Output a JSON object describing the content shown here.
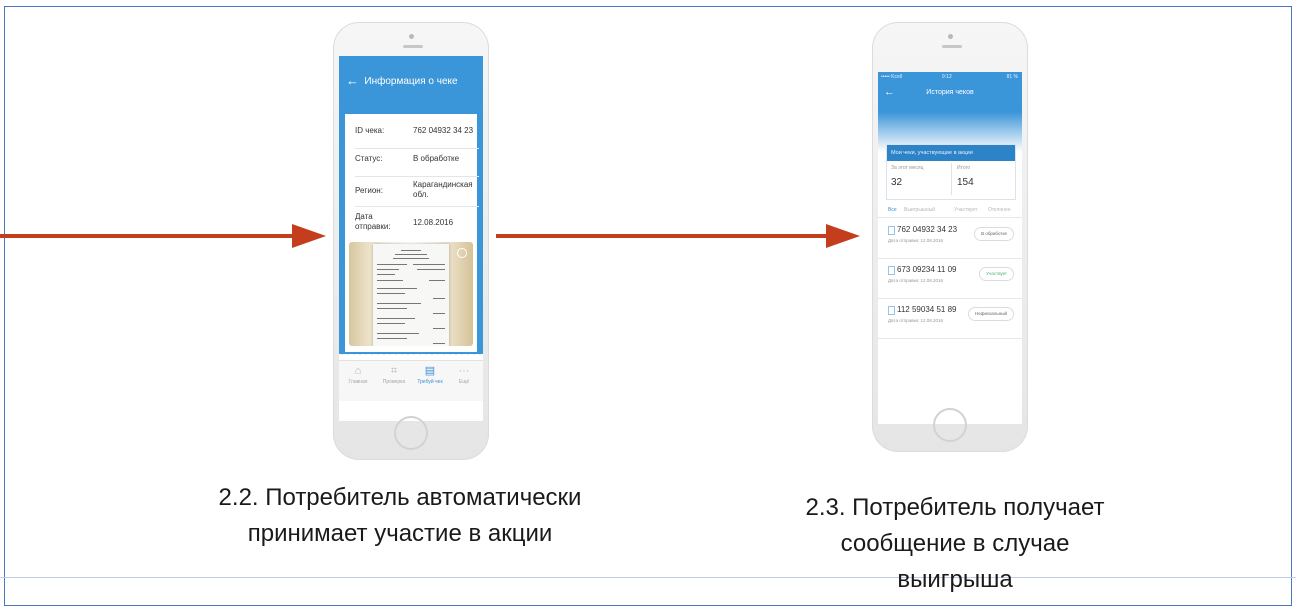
{
  "phone1": {
    "header": {
      "back_icon": "arrow-left-icon",
      "title": "Информация о чеке"
    },
    "fields": [
      {
        "key": "ID чека:",
        "value": "762 04932 34 23"
      },
      {
        "key": "Статус:",
        "value": "В обработке"
      },
      {
        "key": "Регион:",
        "value": "Карагандинская обл."
      },
      {
        "key": "Дата отправки:",
        "value": "12.08.2016"
      }
    ],
    "tabs": [
      {
        "label": "Главная",
        "icon": "home-icon"
      },
      {
        "label": "Проверка",
        "icon": "scan-icon"
      },
      {
        "label": "Требуй чек",
        "icon": "receipt-icon"
      },
      {
        "label": "Ещё",
        "icon": "more-icon"
      }
    ],
    "active_tab": 2
  },
  "phone2": {
    "status_bar": {
      "carrier": "••••• Kcell",
      "time": "9:12",
      "battery": "81 %"
    },
    "header": {
      "back_icon": "arrow-left-icon",
      "title": "История чеков"
    },
    "summary": {
      "title": "Мои чеки, участвующие в акции",
      "month_label": "За этот месяц",
      "month_value": "32",
      "total_label": "Итого",
      "total_value": "154"
    },
    "filters": [
      "Все",
      "Выигрышный",
      "Участвует",
      "Отклонен"
    ],
    "receipts": [
      {
        "number": "762 04932 34 23",
        "date": "Дата отправки: 12.08.2016",
        "status": "В обработке"
      },
      {
        "number": "673 09234 11 09",
        "date": "Дата отправки: 12.08.2016",
        "status": "Участвует"
      },
      {
        "number": "112 59034 51 89",
        "date": "Дата отправки: 12.08.2016",
        "status": "Нефискальный"
      }
    ]
  },
  "captions": {
    "left": [
      "2.2. Потребитель автоматически",
      "принимает участие в акции"
    ],
    "right": [
      "2.3. Потребитель получает",
      "сообщение в случае",
      "выигрыша"
    ]
  },
  "colors": {
    "arrow": "#c43d1c",
    "app_blue": "#3b95d9",
    "frame": "#4a78c2"
  }
}
